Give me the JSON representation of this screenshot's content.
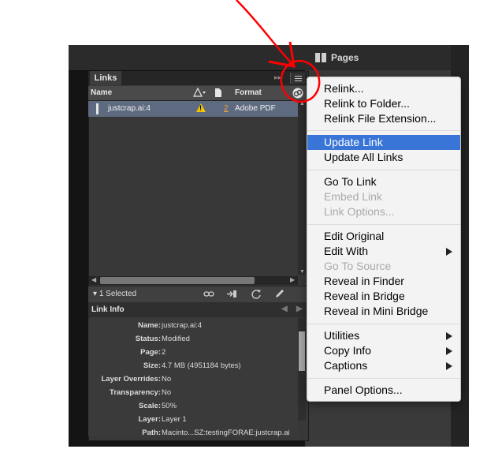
{
  "pages_panel": {
    "title": "Pages"
  },
  "links_panel": {
    "tab": "Links",
    "columns": {
      "name": "Name",
      "page": "",
      "format": "Format"
    },
    "rows": [
      {
        "name": "justcrap.ai:4",
        "page": "2",
        "format": "Adobe PDF",
        "status": "warning"
      }
    ],
    "selection": "1 Selected"
  },
  "link_info": {
    "title": "Link Info",
    "fields": [
      {
        "key": "Name:",
        "value": "justcrap.ai:4"
      },
      {
        "key": "Status:",
        "value": "Modified"
      },
      {
        "key": "Page:",
        "value": "2"
      },
      {
        "key": "Size:",
        "value": "4.7 MB (4951184 bytes)"
      },
      {
        "key": "Layer Overrides:",
        "value": "No"
      },
      {
        "key": "Transparency:",
        "value": "No"
      },
      {
        "key": "Scale:",
        "value": "50%"
      },
      {
        "key": "Layer:",
        "value": "Layer 1"
      },
      {
        "key": "Path:",
        "value": "Macinto...SZ:testingFORAE:justcrap.ai"
      }
    ]
  },
  "menu": {
    "items": [
      {
        "label": "Relink...",
        "enabled": true
      },
      {
        "label": "Relink to Folder...",
        "enabled": true
      },
      {
        "label": "Relink File Extension...",
        "enabled": true
      },
      {
        "label": "Update Link",
        "enabled": true,
        "highlighted": true
      },
      {
        "label": "Update All Links",
        "enabled": true
      },
      {
        "label": "Go To Link",
        "enabled": true
      },
      {
        "label": "Embed Link",
        "enabled": false
      },
      {
        "label": "Link Options...",
        "enabled": false
      },
      {
        "label": "Edit Original",
        "enabled": true
      },
      {
        "label": "Edit With",
        "enabled": true,
        "submenu": true
      },
      {
        "label": "Go To Source",
        "enabled": false
      },
      {
        "label": "Reveal in Finder",
        "enabled": true
      },
      {
        "label": "Reveal in Bridge",
        "enabled": true
      },
      {
        "label": "Reveal in Mini Bridge",
        "enabled": true
      },
      {
        "label": "Utilities",
        "enabled": true,
        "submenu": true
      },
      {
        "label": "Copy Info",
        "enabled": true,
        "submenu": true
      },
      {
        "label": "Captions",
        "enabled": true,
        "submenu": true
      },
      {
        "label": "Panel Options...",
        "enabled": true
      }
    ]
  },
  "colors": {
    "menu_highlight": "#3875d7",
    "annotation": "#ff0000",
    "warning": "#f2c500",
    "selected_row": "#5e6a80"
  },
  "icons": [
    "pages-icon",
    "warning-icon",
    "relink-icon",
    "goto-link-icon",
    "update-link-icon",
    "edit-original-icon",
    "panel-menu-icon",
    "link-badge-icon"
  ]
}
